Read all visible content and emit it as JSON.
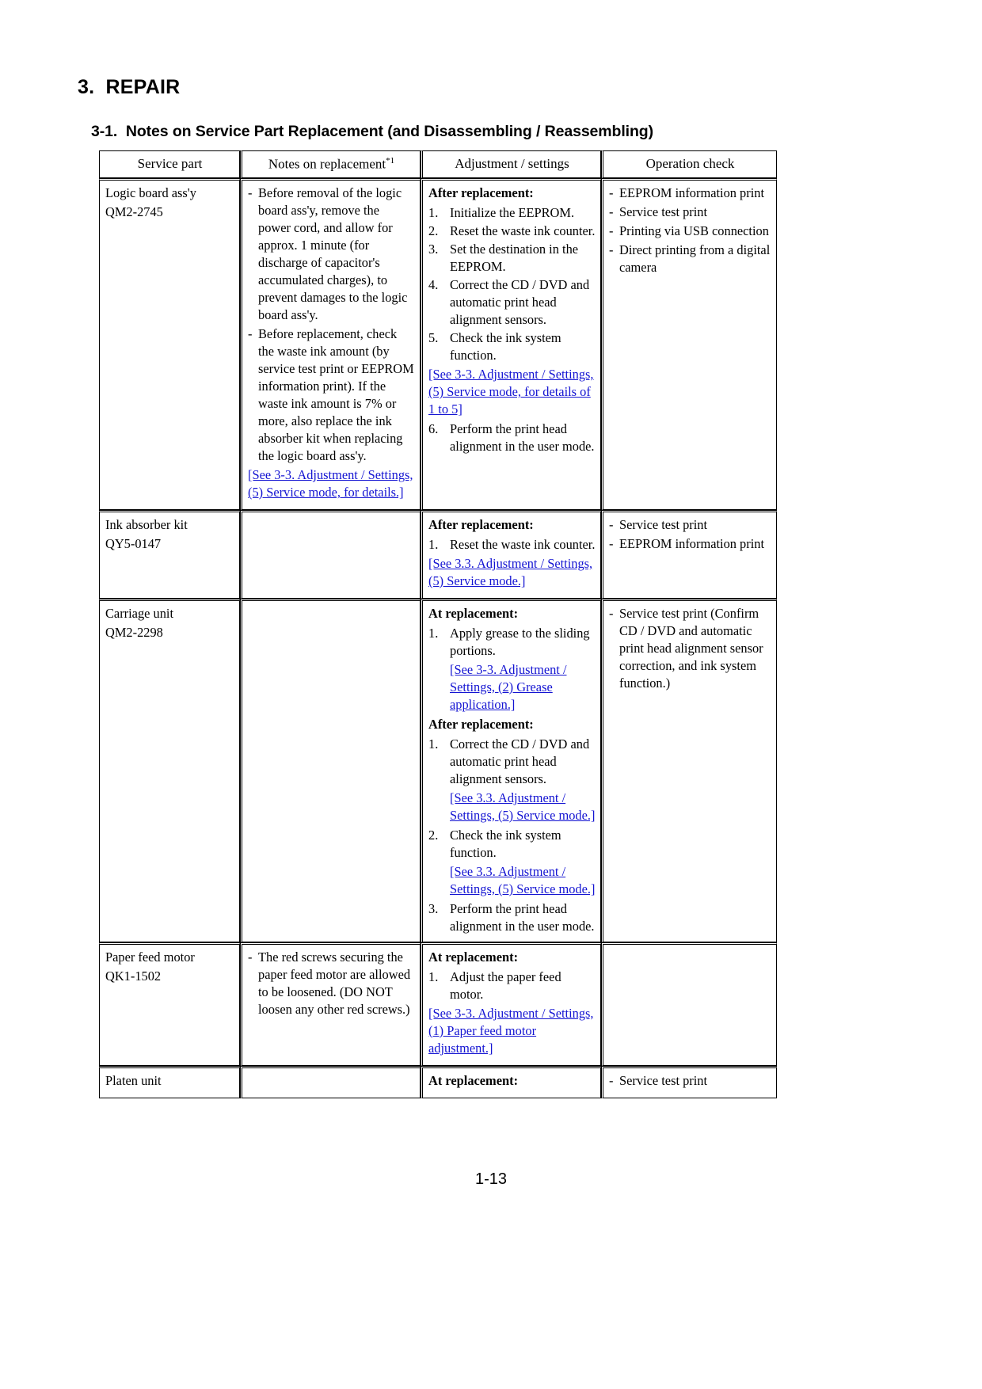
{
  "document": {
    "section_number": "3.",
    "section_title": "REPAIR",
    "subsection": "3-1.  Notes on Service Part Replacement (and Disassembling / Reassembling)",
    "page_number": "1-13"
  },
  "link_color": "#1414d2",
  "table": {
    "headers": {
      "service_part": "Service part",
      "notes": "Notes on replacement",
      "notes_sup": "*1",
      "adjustment": "Adjustment / settings",
      "operation": "Operation check"
    },
    "rows": [
      {
        "part_name": "Logic board ass'y",
        "part_number": "QM2-2745",
        "notes": [
          "Before removal of the logic board ass'y, remove the power cord, and allow for approx. 1 minute (for discharge of capacitor's accumulated charges), to prevent damages to the logic board ass'y.",
          "Before replacement, check the waste ink amount (by service test print or EEPROM information print). If the waste ink amount is 7% or more, also replace the ink absorber kit when replacing the logic board ass'y."
        ],
        "notes_link": "[See 3-3. Adjustment / Settings, (5) Service mode, for details.]",
        "adjustment_label": "After replacement:",
        "adjustment_steps": [
          "Initialize the EEPROM.",
          "Reset the waste ink counter.",
          "Set the destination in the EEPROM.",
          "Correct the CD / DVD and automatic print head alignment sensors.",
          "Check the ink system function."
        ],
        "adjustment_link": "[See 3-3. Adjustment / Settings, (5) Service mode, for details of 1 to 5]",
        "adjustment_step_last": "Perform the print head alignment in the user mode.",
        "adjustment_step_last_number": "6.",
        "operation": [
          "EEPROM information print",
          "Service test print",
          "Printing via USB connection",
          "Direct printing from a digital camera"
        ]
      },
      {
        "part_name": "Ink absorber kit",
        "part_number": "QY5-0147",
        "notes": [],
        "adjustment_label": "After replacement:",
        "adjustment_steps": [
          "Reset the waste ink counter."
        ],
        "adjustment_link": "[See 3.3. Adjustment / Settings, (5) Service mode.]",
        "operation": [
          "Service test print",
          "EEPROM information print"
        ]
      },
      {
        "part_name": "Carriage unit",
        "part_number": "QM2-2298",
        "notes": [],
        "at_label": "At replacement:",
        "at_steps": [
          "Apply grease to the sliding portions."
        ],
        "at_link": "[See 3-3. Adjustment / Settings, (2) Grease application.]",
        "after_label": "After replacement:",
        "after_step_1": "Correct the CD / DVD and automatic print head alignment sensors.",
        "after_link_1": "[See 3.3. Adjustment / Settings, (5) Service mode.]",
        "after_step_2": "Check the ink system function.",
        "after_link_2": "[See 3.3. Adjustment / Settings, (5) Service mode.]",
        "after_step_3": "Perform the print head alignment in the user mode.",
        "operation": [
          "Service test print (Confirm CD / DVD and automatic print head alignment sensor correction, and ink system function.)"
        ]
      },
      {
        "part_name": "Paper feed motor",
        "part_number": "QK1-1502",
        "notes": [
          "The red screws securing the paper feed motor are allowed to be loosened. (DO NOT loosen any other red screws.)"
        ],
        "at_label": "At replacement:",
        "at_steps": [
          "Adjust the paper feed motor."
        ],
        "at_link": "[See 3-3. Adjustment / Settings, (1) Paper feed motor adjustment.]",
        "operation": []
      },
      {
        "part_name": "Platen unit",
        "part_number": "",
        "notes": [],
        "at_label": "At replacement:",
        "at_steps": [],
        "operation": [
          "Service test print"
        ]
      }
    ]
  }
}
